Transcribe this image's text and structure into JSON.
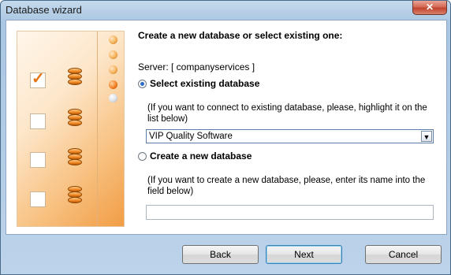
{
  "window": {
    "title": "Database wizard",
    "close_glyph": "✕"
  },
  "steps": [
    {
      "state": "done"
    },
    {
      "state": "done"
    },
    {
      "state": "done"
    },
    {
      "state": "current"
    },
    {
      "state": "todo"
    }
  ],
  "main": {
    "heading": "Create a new database or select existing one:",
    "server": "Server: [ companyservices ]",
    "options": [
      {
        "label": "Select existing database",
        "selected": true,
        "hint": "(If you want to connect to existing database, please, highlight it on the list below)",
        "value": "VIP Quality Software"
      },
      {
        "label": "Create a new database",
        "selected": false,
        "hint": "(If you want to create a new database, please, enter its name into the field below)",
        "value": ""
      }
    ]
  },
  "buttons": {
    "back": "Back",
    "next": "Next",
    "cancel": "Cancel"
  },
  "colors": {
    "accent": "#f07a1a",
    "window_frame": "#a9c6e2"
  }
}
